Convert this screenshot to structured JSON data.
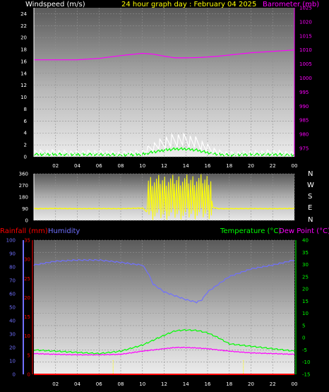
{
  "header": {
    "windspeed_label": "Windspeed (m/s)",
    "title": "24 hour graph day : February 04 2025",
    "barometer_label": "Barometer (mb)"
  },
  "bottom_header": {
    "rainfall_label": "Rainfall (mm)",
    "humidity_label": "Humidity",
    "temperature_label": "Temperature (°C)",
    "dewpoint_label": "Dew Point (°C)"
  },
  "compass": [
    "N",
    "W",
    "S",
    "E",
    "N"
  ],
  "colors": {
    "windspeed": "#ffffff",
    "gust": "#00ff00",
    "barometer": "#ff00ff",
    "direction": "#ffff00",
    "rainfall": "#ff0000",
    "humidity": "#7070ff",
    "temperature": "#00ff00",
    "dewpoint": "#ff00ff",
    "day_marker": "#ffff00"
  },
  "chart_data": [
    {
      "type": "line",
      "title": "24 hour graph day : February 04 2025",
      "x_ticks": [
        "02",
        "04",
        "06",
        "08",
        "10",
        "12",
        "14",
        "16",
        "18",
        "20",
        "22",
        "00"
      ],
      "left_axis": {
        "label": "Windspeed (m/s)",
        "ticks": [
          0,
          2,
          4,
          6,
          8,
          10,
          12,
          14,
          16,
          18,
          20,
          22,
          24
        ],
        "range": [
          0,
          25
        ]
      },
      "right_axis": {
        "label": "Barometer (mb)",
        "ticks": [
          975,
          980,
          985,
          990,
          995,
          1000,
          1005,
          1010,
          1015,
          1020,
          1025
        ],
        "range": [
          972,
          1025
        ]
      },
      "series": [
        {
          "name": "Barometer (mb)",
          "axis": "right",
          "x": [
            0,
            2,
            4,
            6,
            8,
            10,
            11,
            12,
            13,
            14,
            15,
            16,
            17,
            18,
            20,
            22,
            24
          ],
          "values": [
            1006.5,
            1006.5,
            1006.5,
            1007,
            1008,
            1008.8,
            1008.5,
            1007.8,
            1007.2,
            1007.2,
            1007.3,
            1007.5,
            1007.8,
            1008.2,
            1009,
            1009.5,
            1010
          ]
        },
        {
          "name": "Windspeed (m/s)",
          "axis": "left",
          "x": [
            0,
            2,
            4,
            6,
            8,
            10,
            11,
            12,
            13,
            14,
            15,
            16,
            17,
            18,
            20,
            22,
            24
          ],
          "values": [
            0.6,
            0.6,
            0.5,
            0.6,
            0.4,
            0.6,
            1.4,
            2.0,
            2.4,
            2.4,
            2.0,
            1.2,
            0.6,
            0.4,
            0.5,
            0.6,
            0.4
          ]
        },
        {
          "name": "Gust (m/s)",
          "axis": "left",
          "x": [
            0,
            2,
            4,
            6,
            8,
            10,
            11,
            12,
            13,
            14,
            15,
            16,
            17,
            18,
            20,
            22,
            24
          ],
          "values": [
            0.2,
            0.2,
            0.2,
            0.2,
            0.1,
            0.2,
            0.6,
            0.9,
            1.1,
            1.1,
            0.9,
            0.5,
            0.2,
            0.1,
            0.2,
            0.2,
            0.1
          ]
        }
      ]
    },
    {
      "type": "line",
      "title": "Wind direction",
      "y_ticks": [
        0,
        90,
        180,
        270,
        360
      ],
      "y_range": [
        0,
        360
      ],
      "series": [
        {
          "name": "Wind direction",
          "x": [
            0,
            2,
            4,
            6,
            8,
            10,
            10.5,
            11,
            11.5,
            12,
            12.5,
            13,
            13.5,
            14,
            14.5,
            15,
            15.5,
            16,
            16.5,
            17,
            18,
            20,
            22,
            24
          ],
          "values": [
            90,
            92,
            90,
            91,
            90,
            95,
            60,
            330,
            40,
            350,
            30,
            340,
            20,
            350,
            40,
            330,
            30,
            340,
            100,
            90,
            90,
            91,
            90,
            92
          ]
        }
      ]
    },
    {
      "type": "line",
      "title": "",
      "x_ticks": [
        "02",
        "04",
        "06",
        "08",
        "10",
        "12",
        "14",
        "16",
        "18",
        "20",
        "22",
        "00"
      ],
      "humidity_axis": {
        "label": "Humidity",
        "ticks": [
          0,
          10,
          20,
          30,
          40,
          50,
          60,
          70,
          80,
          90,
          100
        ]
      },
      "rain_axis": {
        "label": "Rainfall (mm)",
        "ticks": [
          0,
          5,
          10,
          15,
          20,
          25,
          30,
          35
        ],
        "range": [
          0,
          35
        ]
      },
      "temp_axis": {
        "label": "Temperature (°C)",
        "ticks": [
          -15,
          -10,
          -5,
          0,
          5,
          10,
          15,
          20,
          25,
          30,
          35,
          40
        ],
        "range": [
          -15,
          40
        ]
      },
      "day_markers": [
        7.3,
        19.3
      ],
      "series": [
        {
          "name": "Humidity",
          "axis": "rain",
          "x": [
            0,
            2,
            4,
            6,
            8,
            9,
            10,
            10.5,
            11,
            12,
            13,
            14,
            15,
            15.5,
            16,
            17,
            18,
            20,
            22,
            24
          ],
          "values": [
            28.5,
            29.5,
            29.8,
            29.8,
            29.2,
            28.8,
            28.5,
            26.5,
            23.5,
            21.5,
            20.5,
            19.5,
            18.8,
            19.5,
            21.5,
            23.5,
            25.5,
            27.5,
            28.5,
            29.8
          ]
        },
        {
          "name": "Temperature (°C)",
          "axis": "temp",
          "x": [
            0,
            2,
            4,
            6,
            8,
            10,
            11,
            12,
            13,
            14,
            15,
            16,
            17,
            18,
            20,
            22,
            24
          ],
          "values": [
            -5,
            -5.5,
            -6,
            -6.5,
            -5.5,
            -3,
            -1,
            1,
            2.8,
            3.2,
            3,
            2,
            0,
            -2.5,
            -3.5,
            -4.5,
            -5.5
          ]
        },
        {
          "name": "Dew Point (°C)",
          "axis": "temp",
          "x": [
            0,
            2,
            4,
            6,
            8,
            10,
            12,
            13,
            14,
            15,
            16,
            18,
            20,
            22,
            24
          ],
          "values": [
            -6.5,
            -6.8,
            -7,
            -7,
            -6.8,
            -5.5,
            -4.5,
            -4,
            -4,
            -4.2,
            -4.5,
            -5.5,
            -6.2,
            -6.5,
            -6.8
          ]
        },
        {
          "name": "Rainfall (mm)",
          "axis": "rain",
          "x": [
            0,
            24
          ],
          "values": [
            0,
            0
          ]
        }
      ]
    }
  ]
}
